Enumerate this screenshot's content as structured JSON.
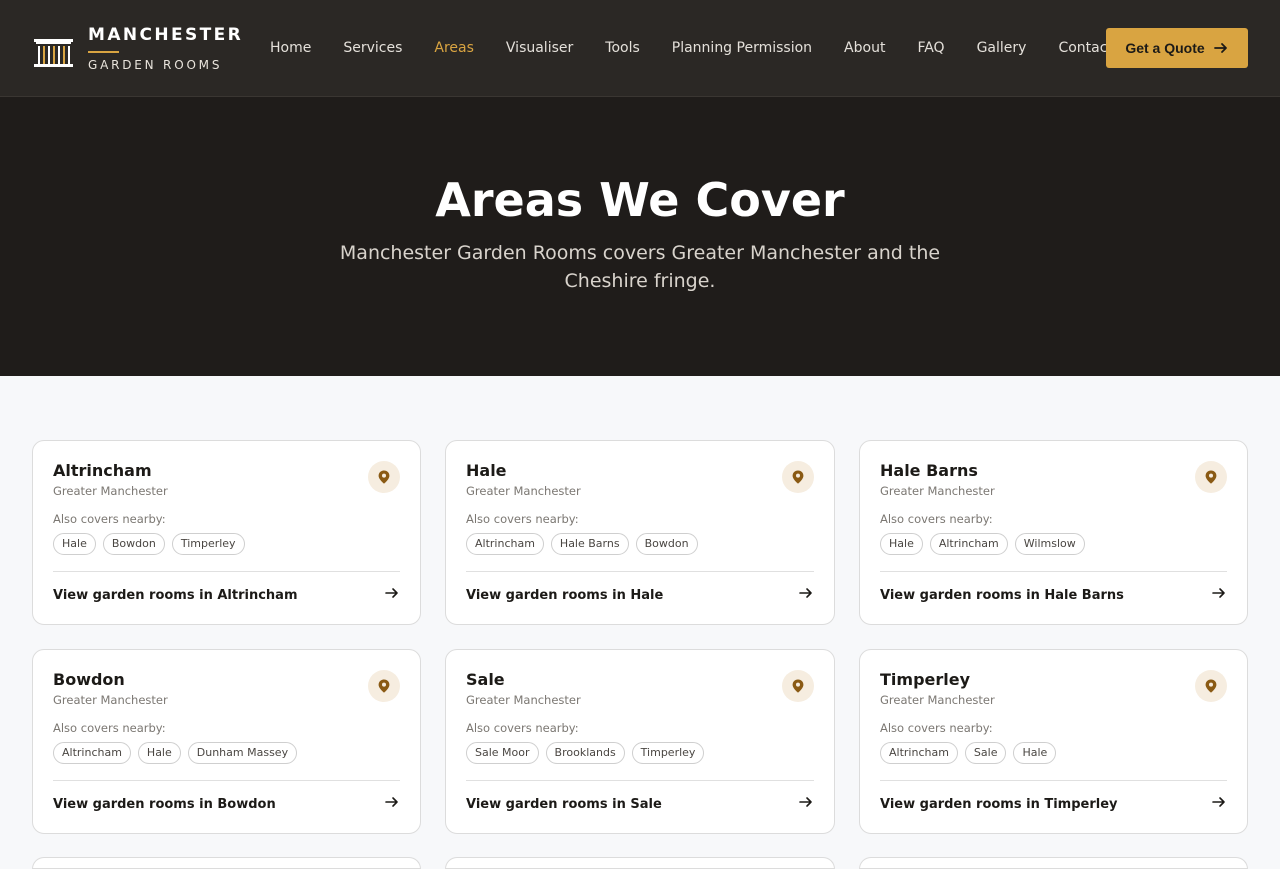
{
  "brand": {
    "line1": "MANCHESTER",
    "line2": "GARDEN ROOMS"
  },
  "nav": {
    "items": [
      {
        "label": "Home",
        "active": false
      },
      {
        "label": "Services",
        "active": false
      },
      {
        "label": "Areas",
        "active": true
      },
      {
        "label": "Visualiser",
        "active": false
      },
      {
        "label": "Tools",
        "active": false
      },
      {
        "label": "Planning Permission",
        "active": false
      },
      {
        "label": "About",
        "active": false
      },
      {
        "label": "FAQ",
        "active": false
      },
      {
        "label": "Gallery",
        "active": false
      },
      {
        "label": "Contact",
        "active": false
      }
    ],
    "cta_label": "Get a Quote"
  },
  "hero": {
    "title": "Areas We Cover",
    "subtitle": "Manchester Garden Rooms covers Greater Manchester and the Cheshire fringe."
  },
  "nearby_label": "Also covers nearby:",
  "areas": [
    {
      "name": "Altrincham",
      "region": "Greater Manchester",
      "nearby": [
        "Hale",
        "Bowdon",
        "Timperley"
      ],
      "link": "View garden rooms in Altrincham"
    },
    {
      "name": "Hale",
      "region": "Greater Manchester",
      "nearby": [
        "Altrincham",
        "Hale Barns",
        "Bowdon"
      ],
      "link": "View garden rooms in Hale"
    },
    {
      "name": "Hale Barns",
      "region": "Greater Manchester",
      "nearby": [
        "Hale",
        "Altrincham",
        "Wilmslow"
      ],
      "link": "View garden rooms in Hale Barns"
    },
    {
      "name": "Bowdon",
      "region": "Greater Manchester",
      "nearby": [
        "Altrincham",
        "Hale",
        "Dunham Massey"
      ],
      "link": "View garden rooms in Bowdon"
    },
    {
      "name": "Sale",
      "region": "Greater Manchester",
      "nearby": [
        "Sale Moor",
        "Brooklands",
        "Timperley"
      ],
      "link": "View garden rooms in Sale"
    },
    {
      "name": "Timperley",
      "region": "Greater Manchester",
      "nearby": [
        "Altrincham",
        "Sale",
        "Hale"
      ],
      "link": "View garden rooms in Timperley"
    }
  ],
  "colors": {
    "accent": "#d9a441",
    "nav_bg": "#2b2825",
    "hero_bg": "#1f1c1a",
    "pin": "#8a5a14"
  },
  "icons": {
    "logo": "garden-room-icon",
    "cta": "arrow-right-icon",
    "card_pin": "map-pin-icon",
    "card_link": "arrow-right-icon"
  }
}
